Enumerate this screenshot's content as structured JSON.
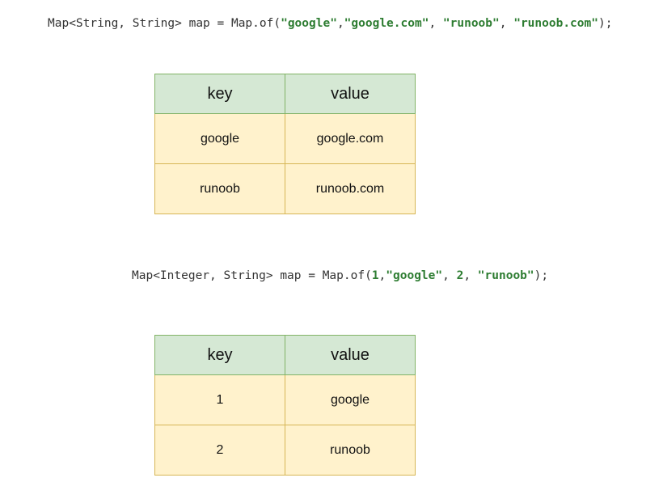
{
  "colors": {
    "header_fill": "#d5e8d4",
    "header_border": "#82b366",
    "cell_fill": "#fff2cc",
    "cell_border": "#d6b656",
    "string_literal": "#2e7d32"
  },
  "example_1": {
    "code": {
      "prefix": "Map<String, String> map = Map.of(",
      "arg1": "\"google\"",
      "sep1": ",",
      "arg2": "\"google.com\"",
      "sep2": ", ",
      "arg3": "\"runoob\"",
      "sep3": ", ",
      "arg4": "\"runoob.com\"",
      "suffix": ");"
    },
    "table": {
      "headers": [
        "key",
        "value"
      ],
      "rows": [
        [
          "google",
          "google.com"
        ],
        [
          "runoob",
          "runoob.com"
        ]
      ]
    }
  },
  "example_2": {
    "code": {
      "prefix": "Map<Integer, String> map = Map.of(",
      "arg1": "1",
      "sep1": ",",
      "arg2": "\"google\"",
      "sep2": ", ",
      "arg3": "2",
      "sep3": ", ",
      "arg4": "\"runoob\"",
      "suffix": ");"
    },
    "table": {
      "headers": [
        "key",
        "value"
      ],
      "rows": [
        [
          "1",
          "google"
        ],
        [
          "2",
          "runoob"
        ]
      ]
    }
  }
}
